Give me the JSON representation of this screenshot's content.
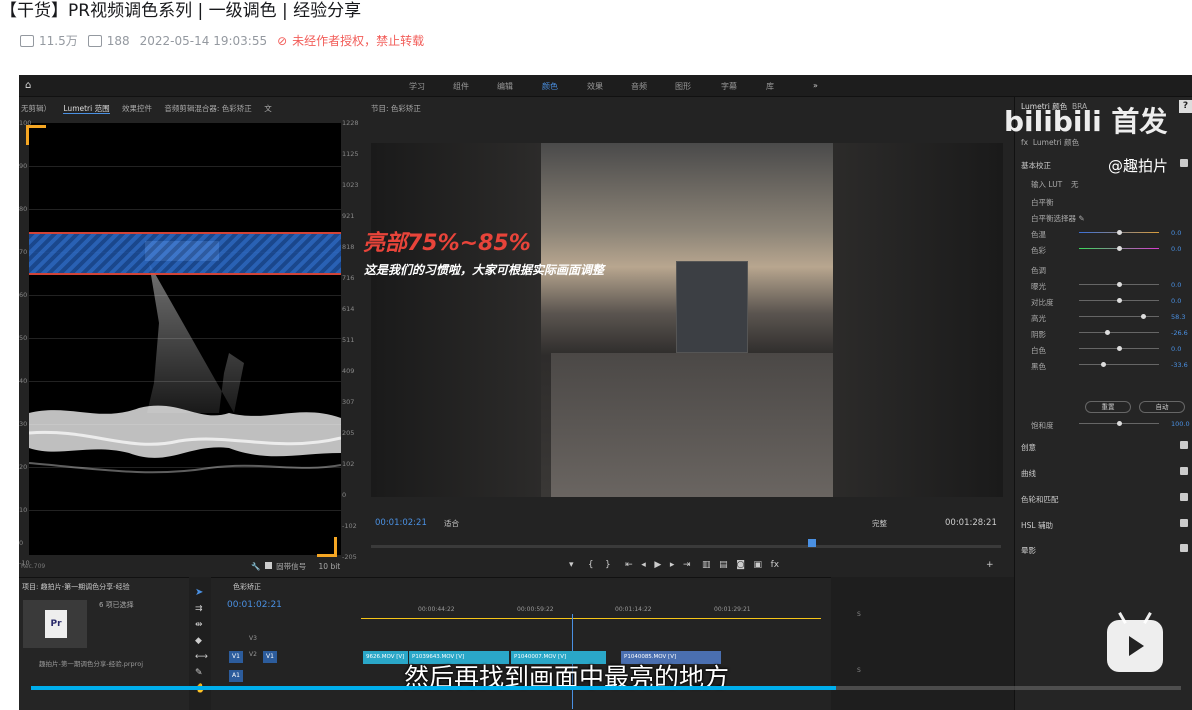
{
  "page": {
    "title": "【干货】PR视频调色系列 | 一级调色 | 经验分享",
    "views": "11.5万",
    "danmaku": "188",
    "datetime": "2022-05-14 19:03:55",
    "copyright": "未经作者授权，禁止转载"
  },
  "premiere": {
    "workspaces": [
      "学习",
      "组件",
      "编辑",
      "颜色",
      "效果",
      "音频",
      "图形",
      "字幕",
      "库"
    ],
    "active_workspace": "颜色",
    "more": "»",
    "left_tabs": [
      "无剪辑）",
      "Lumetri 范围",
      "效果控件",
      "音频剪辑混合器: 色彩矫正",
      "文"
    ],
    "program_tab": "节目: 色彩矫正",
    "scope_left_labels": [
      "100",
      "90",
      "80",
      "70",
      "60",
      "50",
      "40",
      "30",
      "20",
      "10",
      "0",
      "-10"
    ],
    "scope_right_labels": [
      "1228",
      "1125",
      "1023",
      "921",
      "818",
      "716",
      "614",
      "511",
      "409",
      "307",
      "205",
      "102",
      "0",
      "-102",
      "-205"
    ],
    "scope_footer": "10 bit",
    "scope_footer_left": "Rec.709",
    "scope_signal_label": "固带信号",
    "overlay_title": "亮部75%~85%",
    "overlay_subtitle": "这是我们的习惯啦，大家可根据实际画面调整",
    "tc_current": "00:01:02:21",
    "tc_duration": "00:01:28:21",
    "fit_label": "适合",
    "quality_label": "完整",
    "playhead_fraction": 0.7
  },
  "lumetri": {
    "tab1": "Lumetri 颜色",
    "tab2": "BRA",
    "fx_label": "fx",
    "fx_name": "Lumetri 颜色",
    "sections": [
      "基本校正",
      "创意",
      "曲线",
      "色轮和匹配",
      "HSL 辅助",
      "晕影"
    ],
    "input_lut_label": "输入 LUT",
    "input_lut_value": "无",
    "white_balance": "白平衡",
    "wb_selector": "白平衡选择器",
    "tone": "色调",
    "rows": [
      {
        "label": "色温",
        "value": "0.0",
        "pos": 0.5
      },
      {
        "label": "色彩",
        "value": "0.0",
        "pos": 0.5
      },
      {
        "label": "曝光",
        "value": "0.0",
        "pos": 0.5
      },
      {
        "label": "对比度",
        "value": "0.0",
        "pos": 0.5
      },
      {
        "label": "高光",
        "value": "58.3",
        "pos": 0.8
      },
      {
        "label": "阴影",
        "value": "-26.6",
        "pos": 0.35
      },
      {
        "label": "白色",
        "value": "0.0",
        "pos": 0.5
      },
      {
        "label": "黑色",
        "value": "-33.6",
        "pos": 0.3
      }
    ],
    "reset_label": "重置",
    "auto_label": "自动",
    "saturation_label": "饱和度",
    "saturation_value": "100.0"
  },
  "project": {
    "tab": "项目: 趣拍片-第一期调色分享-经验",
    "selected": "6 项已选择",
    "file_label": "Pr",
    "footer": "趣拍片-第一期调色分享-经验.prproj"
  },
  "sequence": {
    "tab": "色彩矫正",
    "timecode": "00:01:02:21",
    "ruler": [
      "00:00:44:22",
      "00:00:59:22",
      "00:01:14:22",
      "00:01:29:21"
    ],
    "tracks": [
      "V3",
      "V2",
      "V1",
      "A1"
    ],
    "clips": [
      "9626.MOV [V]",
      "P1039643.MOV [V]",
      "P1040007.MOV [V]",
      "P1040085.MOV [V]"
    ]
  },
  "meter_labels": [
    "S",
    "S"
  ],
  "player": {
    "subtitle": "然后再找到画面中最亮的地方",
    "progress_fraction": 0.7,
    "watermark_title": "bilibili 首发",
    "watermark_user": "@趣拍片",
    "help": "?"
  }
}
